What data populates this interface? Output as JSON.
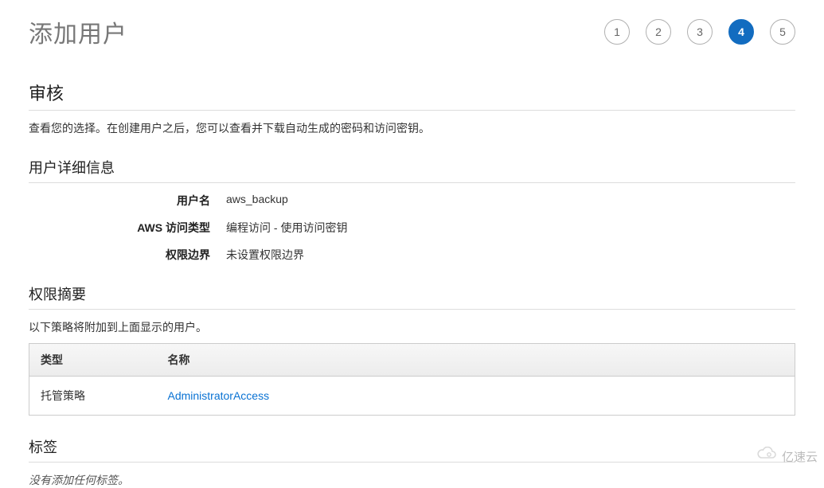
{
  "page": {
    "title": "添加用户"
  },
  "stepper": {
    "steps": [
      "1",
      "2",
      "3",
      "4",
      "5"
    ],
    "active_index": 3
  },
  "review": {
    "title": "审核",
    "description": "查看您的选择。在创建用户之后，您可以查看并下载自动生成的密码和访问密钥。"
  },
  "user_details": {
    "title": "用户详细信息",
    "rows": [
      {
        "label": "用户名",
        "value": "aws_backup"
      },
      {
        "label": "AWS 访问类型",
        "value": "编程访问 - 使用访问密钥"
      },
      {
        "label": "权限边界",
        "value": "未设置权限边界"
      }
    ]
  },
  "permissions": {
    "title": "权限摘要",
    "description": "以下策略将附加到上面显示的用户。",
    "columns": {
      "type": "类型",
      "name": "名称"
    },
    "rows": [
      {
        "type": "托管策略",
        "name": "AdministratorAccess"
      }
    ]
  },
  "tags": {
    "title": "标签",
    "empty_message": "没有添加任何标签。"
  },
  "watermark": {
    "text": "亿速云"
  }
}
